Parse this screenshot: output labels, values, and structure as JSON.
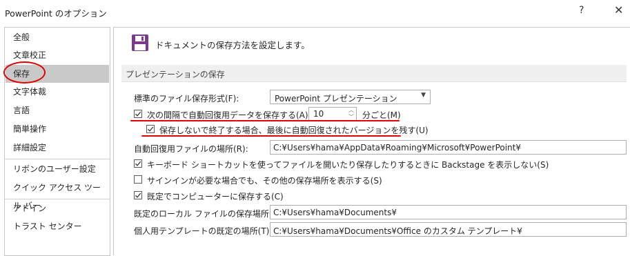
{
  "window": {
    "title": "PowerPoint のオプション",
    "help_label": "?",
    "close_label": "✕"
  },
  "sidebar": {
    "items": [
      {
        "label": "全般"
      },
      {
        "label": "文章校正"
      },
      {
        "label": "保存"
      },
      {
        "label": "文字体裁"
      },
      {
        "label": "言語"
      },
      {
        "label": "簡単操作"
      },
      {
        "label": "詳細設定"
      },
      {
        "label": "リボンのユーザー設定"
      },
      {
        "label": "クイック アクセス ツール バー"
      },
      {
        "label": "アドイン"
      },
      {
        "label": "トラスト センター"
      }
    ],
    "selected": "保存"
  },
  "header": {
    "text": "ドキュメントの保存方法を設定します。",
    "icon": "save-icon"
  },
  "section": {
    "title": "プレゼンテーションの保存"
  },
  "settings": {
    "default_format_label": "標準のファイル保存形式(F):",
    "default_format_value": "PowerPoint プレゼンテーション",
    "autorecover_label": "次の間隔で自動回復用データを保存する(A):",
    "autorecover_checked": true,
    "autorecover_minutes": "10",
    "minutes_unit": "分ごと(M)",
    "keep_last_label": "保存しないで終了する場合、最後に自動回復されたバージョンを残す(U)",
    "keep_last_checked": true,
    "autorecover_location_label": "自動回復用ファイルの場所(R):",
    "autorecover_location_value": "C:¥Users¥hama¥AppData¥Roaming¥Microsoft¥PowerPoint¥",
    "backstage_label": "キーボード ショートカットを使ってファイルを開いたり保存したりするときに Backstage を表示しない(S)",
    "backstage_checked": true,
    "show_more_locations_label": "サインインが必要な場合でも、その他の保存場所を表示する(S)",
    "show_more_locations_checked": false,
    "save_to_computer_label": "既定でコンピューターに保存する(C)",
    "save_to_computer_checked": true,
    "local_location_label": "既定のローカル ファイルの保存場所(I):",
    "local_location_value": "C:¥Users¥hama¥Documents¥",
    "template_location_label": "個人用テンプレートの既定の場所(T):",
    "template_location_value": "C:¥Users¥hama¥Documents¥Office のカスタム テンプレート¥"
  },
  "colors": {
    "annotation_red": "#e00000",
    "selected_bg": "#c9c9c9",
    "save_icon": "#7a3b8f"
  }
}
